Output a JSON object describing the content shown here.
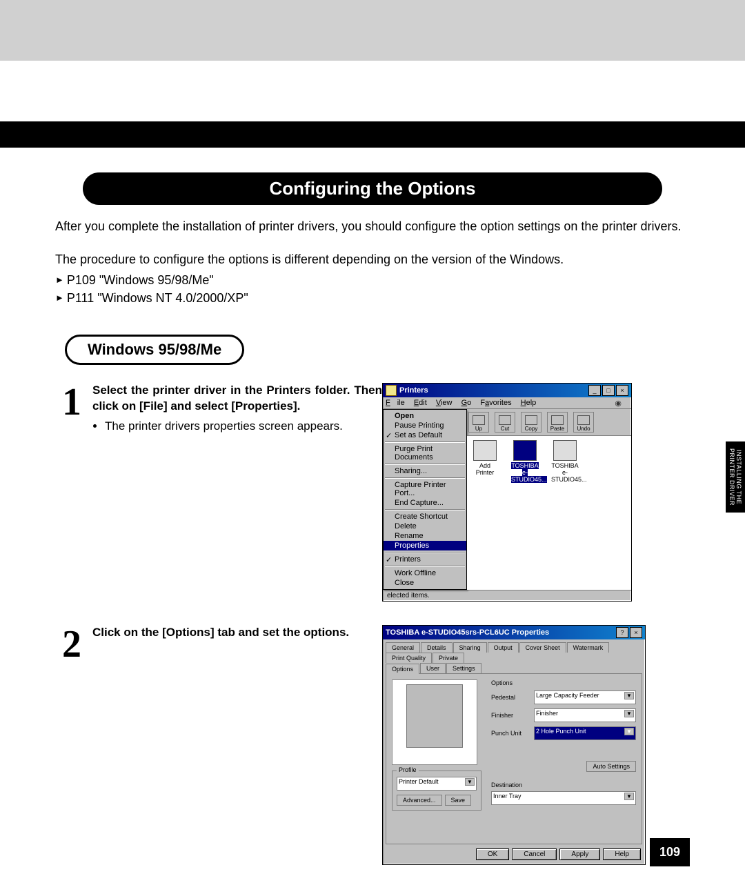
{
  "header": {
    "title": "Configuring the Options"
  },
  "intro": {
    "p1": "After you complete the installation of printer drivers, you should configure the option settings on the printer drivers.",
    "p2": "The procedure to configure the options is different depending on the version of the Windows.",
    "link1": "P109 \"Windows 95/98/Me\"",
    "link2": "P111 \"Windows NT 4.0/2000/XP\""
  },
  "subhead": "Windows 95/98/Me",
  "steps": {
    "s1": {
      "num": "1",
      "bold": "Select the printer driver in the Printers folder. Then click on [File] and select [Properties].",
      "bullet": "The printer drivers properties screen appears."
    },
    "s2": {
      "num": "2",
      "bold": "Click on the [Options] tab and set the options."
    }
  },
  "printers_window": {
    "title": "Printers",
    "menus": {
      "file": "File",
      "edit": "Edit",
      "view": "View",
      "go": "Go",
      "favorites": "Favorites",
      "help": "Help"
    },
    "toolbar_labels": {
      "up": "Up",
      "cut": "Cut",
      "copy": "Copy",
      "paste": "Paste",
      "undo": "Undo"
    },
    "menu_open": "Open",
    "menu_pause": "Pause Printing",
    "menu_default": "Set as Default",
    "menu_purge": "Purge Print Documents",
    "menu_sharing": "Sharing...",
    "menu_capture": "Capture Printer Port...",
    "menu_endcap": "End Capture...",
    "menu_shortcut": "Create Shortcut",
    "menu_delete": "Delete",
    "menu_rename": "Rename",
    "menu_properties": "Properties",
    "menu_printers": "Printers",
    "menu_work": "Work Offline",
    "menu_close": "Close",
    "icon_add": "Add Printer",
    "icon_p1": "TOSHIBA e-STUDIO45...",
    "icon_p2": "TOSHIBA e-STUDIO45...",
    "status": "elected items."
  },
  "properties_dialog": {
    "title": "TOSHIBA e-STUDIO45srs-PCL6UC Properties",
    "tabs": {
      "general": "General",
      "details": "Details",
      "sharing": "Sharing",
      "output": "Output",
      "cover": "Cover Sheet",
      "watermark": "Watermark",
      "quality": "Print Quality",
      "private": "Private",
      "options": "Options",
      "user": "User",
      "settings": "Settings"
    },
    "options_group": "Options",
    "pedestal_label": "Pedestal",
    "pedestal_value": "Large Capacity Feeder",
    "finisher_label": "Finisher",
    "finisher_value": "Finisher",
    "punch_label": "Punch Unit",
    "punch_value": "2 Hole Punch Unit",
    "auto_btn": "Auto Settings",
    "profile_group": "Profile",
    "profile_value": "Printer Default",
    "advanced_btn": "Advanced...",
    "save_btn": "Save",
    "dest_group": "Destination",
    "dest_value": "Inner Tray",
    "ok": "OK",
    "cancel": "Cancel",
    "apply": "Apply",
    "help": "Help"
  },
  "sidetab": {
    "l1": "INSTALLING THE",
    "l2": "PRINTER DRIVER"
  },
  "page_number": "109"
}
